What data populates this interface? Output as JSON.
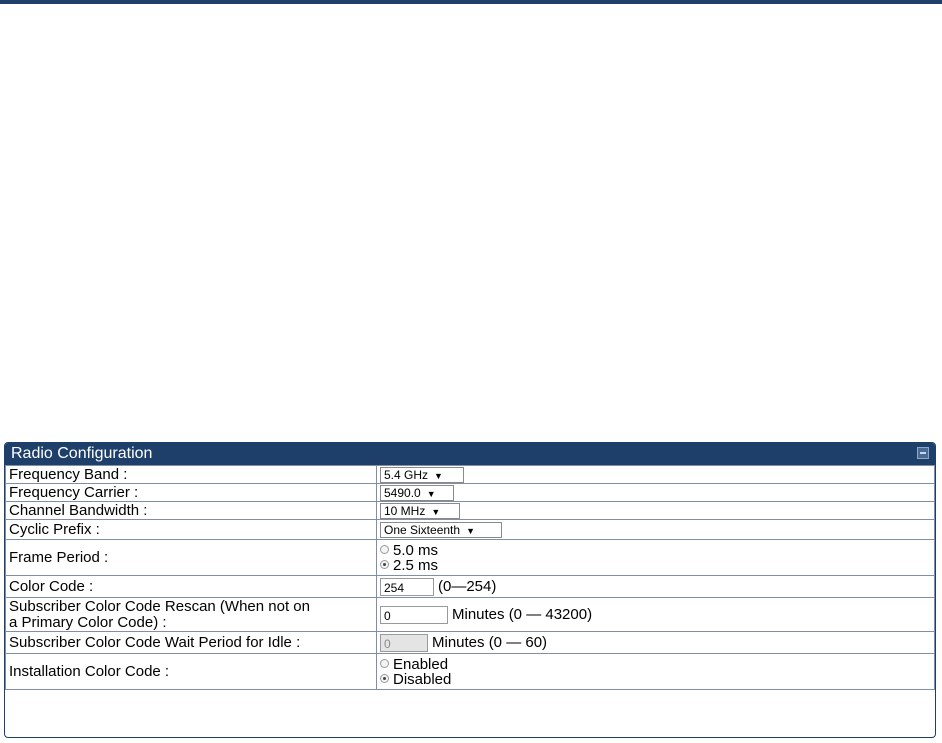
{
  "panel": {
    "title": "Radio Configuration"
  },
  "rows": {
    "frequency_band": {
      "label": "Frequency Band :",
      "value": "5.4 GHz"
    },
    "frequency_carrier": {
      "label": "Frequency Carrier :",
      "value": "5490.0"
    },
    "channel_bandwidth": {
      "label": "Channel Bandwidth :",
      "value": "10 MHz"
    },
    "cyclic_prefix": {
      "label": "Cyclic Prefix :",
      "value": "One Sixteenth"
    },
    "frame_period": {
      "label": "Frame Period :",
      "options": [
        "5.0 ms",
        "2.5 ms"
      ],
      "selected": "2.5 ms"
    },
    "color_code": {
      "label": "Color Code :",
      "value": "254",
      "hint": "(0—254)"
    },
    "rescan": {
      "label_line1": "Subscriber Color Code Rescan (When not on",
      "label_line2": "a Primary Color Code) :",
      "value": "0",
      "hint": "Minutes (0 — 43200)"
    },
    "wait_period": {
      "label": "Subscriber Color Code Wait Period for Idle :",
      "value": "0",
      "hint": "Minutes (0 — 60)",
      "disabled": true
    },
    "installation_color_code": {
      "label": "Installation Color Code :",
      "options": [
        "Enabled",
        "Disabled"
      ],
      "selected": "Disabled"
    }
  },
  "colors": {
    "header_bg": "#1f3f6b",
    "border": "#7f8fa8"
  }
}
